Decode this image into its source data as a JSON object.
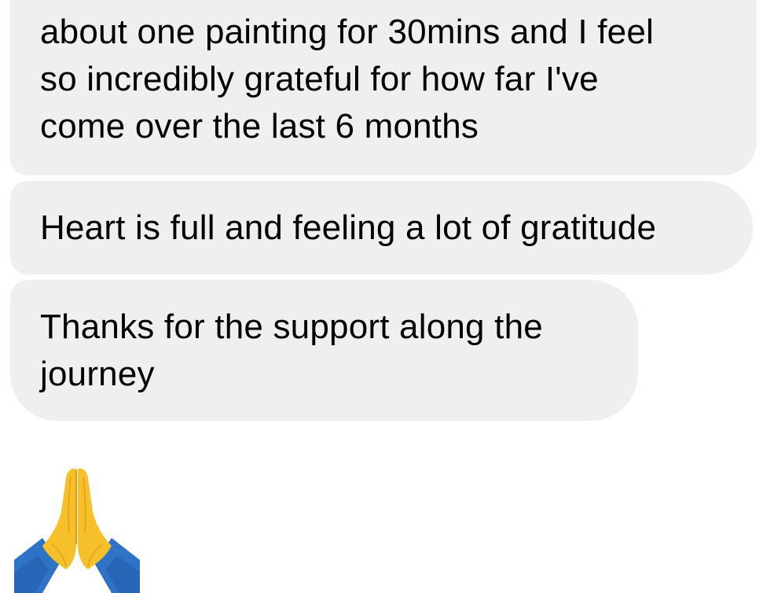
{
  "messages": [
    {
      "lines": [
        "about one painting for 30mins and I feel",
        "so incredibly grateful for how far I've",
        "come over the last 6 months"
      ]
    },
    {
      "lines": [
        "Heart is full and feeling a lot of gratitude"
      ]
    },
    {
      "lines": [
        "Thanks for the support along the",
        "journey"
      ]
    }
  ],
  "reaction": {
    "emoji": "folded-hands-icon",
    "colors": {
      "hands": "#f5c02a",
      "hands_shade": "#d99a14",
      "sleeve": "#2f73c7",
      "sleeve_shade": "#1f5aa6"
    }
  },
  "colors": {
    "bubble": "#efefef",
    "background": "#ffffff",
    "text": "#000000"
  }
}
